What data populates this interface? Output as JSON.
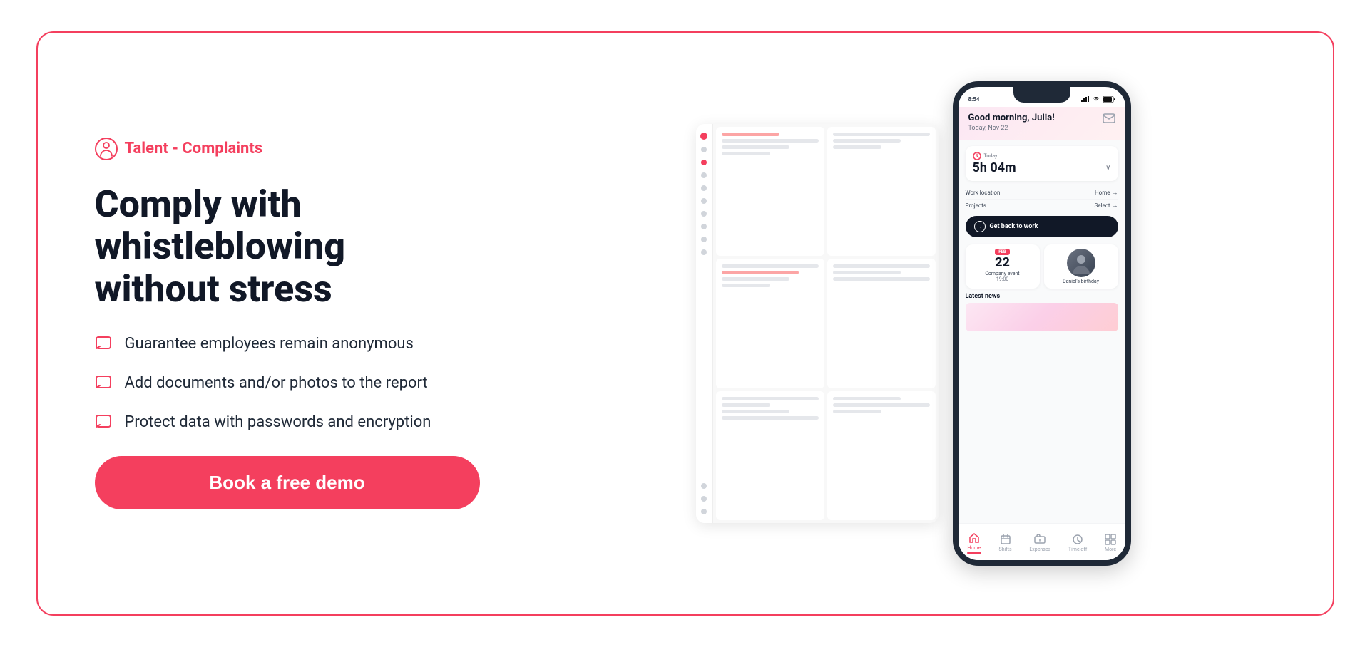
{
  "brand": {
    "title": "Talent - Complaints",
    "icon": "person-complaint-icon"
  },
  "heading": {
    "line1": "Comply with whistleblowing",
    "line2": "without stress"
  },
  "features": [
    {
      "id": "feature-anonymous",
      "icon": "chat-icon",
      "text": "Guarantee employees remain anonymous"
    },
    {
      "id": "feature-documents",
      "icon": "chat-icon",
      "text": "Add documents and/or photos to the report"
    },
    {
      "id": "feature-encryption",
      "icon": "chat-icon",
      "text": "Protect data with passwords and encryption"
    }
  ],
  "cta": {
    "label": "Book a free demo"
  },
  "mobile_app": {
    "status_bar": {
      "time": "8:54",
      "signal": "▲▲▲",
      "wifi": "WiFi",
      "battery": "■"
    },
    "greeting": "Good morning, Julia!",
    "date": "Today, Nov 22",
    "time_tracking": {
      "label": "Today",
      "value": "5h 04m"
    },
    "work_location": {
      "label": "Work location",
      "value": "Home"
    },
    "projects": {
      "label": "Projects",
      "value": "Select"
    },
    "get_back_to_work": "Get back to work",
    "events": [
      {
        "month": "FEB",
        "day": "22",
        "name": "Company event",
        "time": "19:00"
      },
      {
        "name": "Daniel's birthday",
        "has_avatar": true
      }
    ],
    "latest_news": "Latest news",
    "nav": [
      {
        "label": "Home",
        "active": true
      },
      {
        "label": "Shifts",
        "active": false
      },
      {
        "label": "Expenses",
        "active": false
      },
      {
        "label": "Time off",
        "active": false
      },
      {
        "label": "More",
        "active": false
      }
    ]
  }
}
